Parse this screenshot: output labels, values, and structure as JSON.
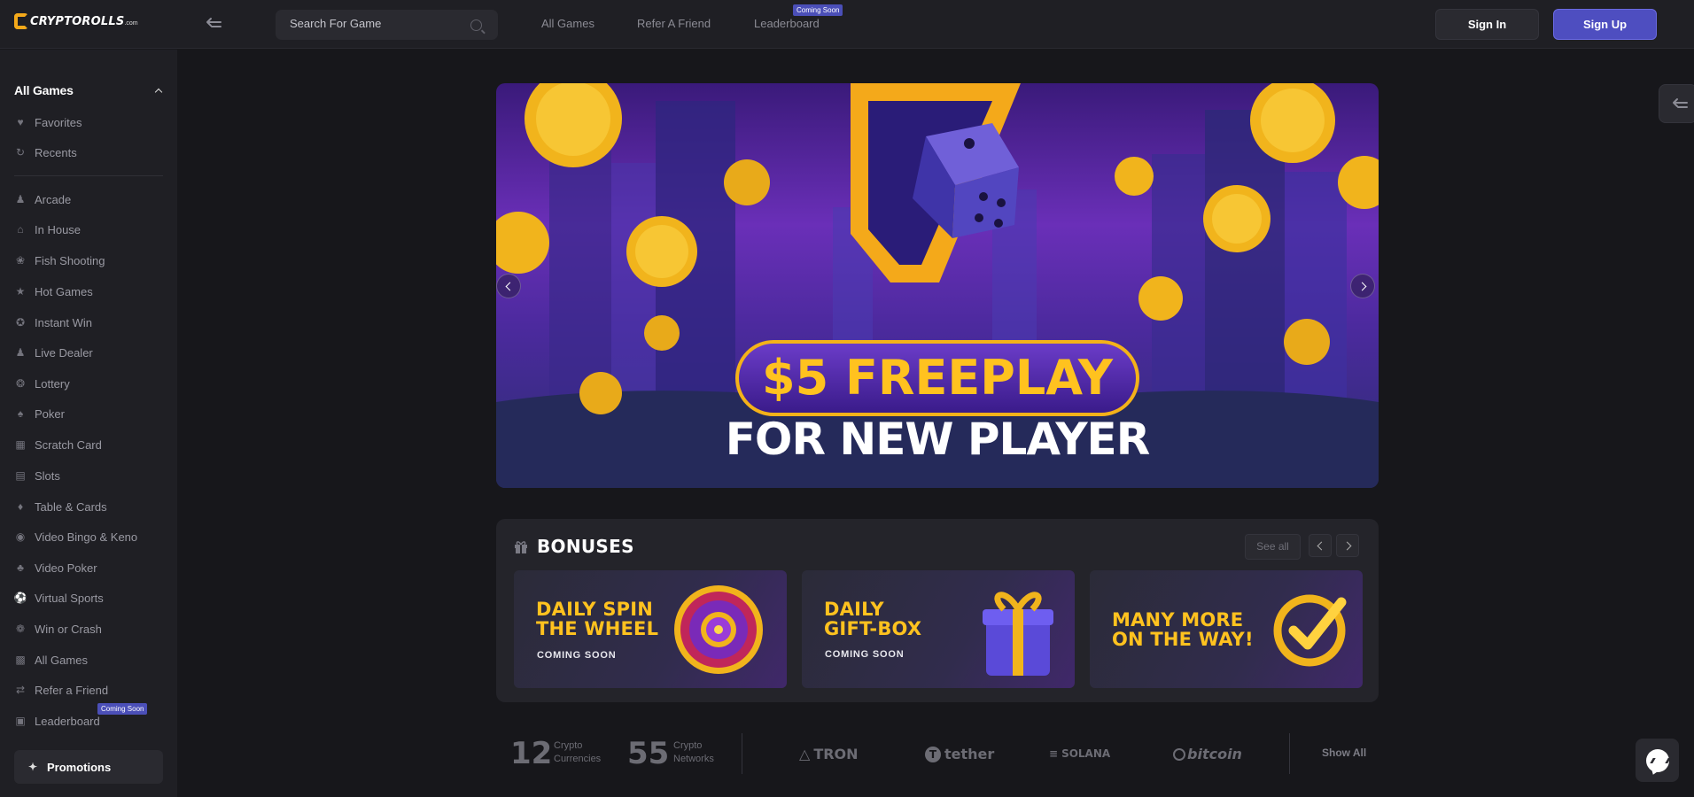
{
  "header": {
    "logo_text": "CRYPTOROLLS",
    "logo_suffix": ".com",
    "search_placeholder": "Search For Game",
    "nav": [
      {
        "label": "All Games"
      },
      {
        "label": "Refer A Friend"
      },
      {
        "label": "Leaderboard",
        "badge": "Coming Soon"
      }
    ],
    "sign_in": "Sign In",
    "sign_up": "Sign Up"
  },
  "sidebar": {
    "section_title": "All Games",
    "top_items": [
      {
        "label": "Favorites",
        "icon": "heart-icon"
      },
      {
        "label": "Recents",
        "icon": "history-icon"
      }
    ],
    "items": [
      {
        "label": "Arcade",
        "icon": "joystick-icon"
      },
      {
        "label": "In House",
        "icon": "house-icon"
      },
      {
        "label": "Fish Shooting",
        "icon": "fish-icon"
      },
      {
        "label": "Hot Games",
        "icon": "star-icon"
      },
      {
        "label": "Instant Win",
        "icon": "medal-icon"
      },
      {
        "label": "Live Dealer",
        "icon": "dealer-icon"
      },
      {
        "label": "Lottery",
        "icon": "lottery-icon"
      },
      {
        "label": "Poker",
        "icon": "cards-icon"
      },
      {
        "label": "Scratch Card",
        "icon": "scratch-icon"
      },
      {
        "label": "Slots",
        "icon": "slots-icon"
      },
      {
        "label": "Table & Cards",
        "icon": "table-icon"
      },
      {
        "label": "Video Bingo & Keno",
        "icon": "bingo-icon"
      },
      {
        "label": "Video Poker",
        "icon": "video-poker-icon"
      },
      {
        "label": "Virtual Sports",
        "icon": "sports-icon"
      },
      {
        "label": "Win or Crash",
        "icon": "crash-icon"
      },
      {
        "label": "All Games",
        "icon": "grid-icon"
      },
      {
        "label": "Refer a Friend",
        "icon": "refer-icon"
      },
      {
        "label": "Leaderboard",
        "icon": "leaderboard-icon",
        "badge": "Coming Soon"
      }
    ],
    "promotions": "Promotions"
  },
  "hero": {
    "headline": "$5 FREEPLAY",
    "subline": "FOR NEW PLAYER"
  },
  "bonuses": {
    "title": "BONUSES",
    "see_all": "See all",
    "cards": [
      {
        "title_line1": "DAILY SPIN",
        "title_line2": "THE WHEEL",
        "subtitle": "COMING SOON"
      },
      {
        "title_line1": "DAILY",
        "title_line2": "GIFT-BOX",
        "subtitle": "COMING SOON"
      },
      {
        "title_line1": "MANY MORE",
        "title_line2": "ON THE WAY!",
        "subtitle": ""
      }
    ]
  },
  "crypto": {
    "currencies_count": "12",
    "currencies_label_1": "Crypto",
    "currencies_label_2": "Currencies",
    "networks_count": "55",
    "networks_label_1": "Crypto",
    "networks_label_2": "Networks",
    "logos": [
      "TRON",
      "tether",
      "SOLANA",
      "bitcoin"
    ],
    "show_all": "Show All"
  },
  "colors": {
    "accent": "#4e4ec0",
    "gold": "#ffc21f",
    "bg": "#17171b",
    "panel": "#1f1f24"
  }
}
